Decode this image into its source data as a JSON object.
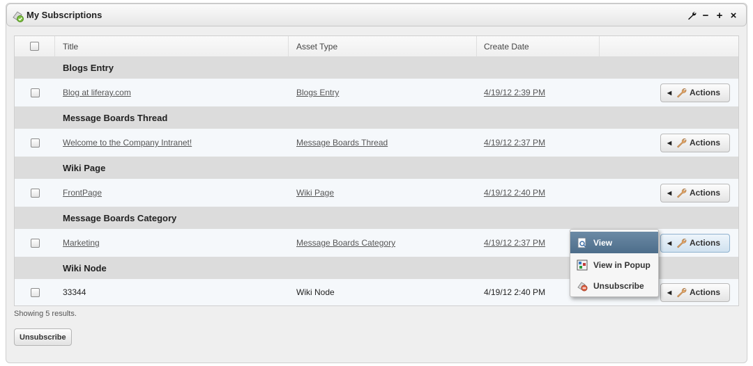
{
  "portlet": {
    "title": "My Subscriptions",
    "controls": {
      "configure_icon": "wrench-icon",
      "minimize": "−",
      "maximize": "+",
      "close": "×"
    }
  },
  "table": {
    "headers": {
      "title": "Title",
      "asset_type": "Asset Type",
      "create_date": "Create Date"
    },
    "groups": [
      {
        "label": "Blogs Entry",
        "row": {
          "title": "Blog at liferay.com",
          "asset_type": "Blogs Entry",
          "create_date": "4/19/12 2:39 PM",
          "linked": true,
          "actions_label": "Actions"
        }
      },
      {
        "label": "Message Boards Thread",
        "row": {
          "title": "Welcome to the Company Intranet!",
          "asset_type": "Message Boards Thread",
          "create_date": "4/19/12 2:37 PM",
          "linked": true,
          "actions_label": "Actions"
        }
      },
      {
        "label": "Wiki Page",
        "row": {
          "title": "FrontPage",
          "asset_type": "Wiki Page",
          "create_date": "4/19/12 2:40 PM",
          "linked": true,
          "actions_label": "Actions"
        }
      },
      {
        "label": "Message Boards Category",
        "row": {
          "title": "Marketing",
          "asset_type": "Message Boards Category",
          "create_date": "4/19/12 2:37 PM",
          "linked": true,
          "actions_label": "Actions"
        }
      },
      {
        "label": "Wiki Node",
        "row": {
          "title": "33344",
          "asset_type": "Wiki Node",
          "create_date": "4/19/12 2:40 PM",
          "linked": false,
          "actions_label": "Actions"
        }
      }
    ]
  },
  "actions_menu": {
    "items": [
      {
        "label": "View",
        "icon": "view-page-icon"
      },
      {
        "label": "View in Popup",
        "icon": "popup-icon"
      },
      {
        "label": "Unsubscribe",
        "icon": "unsubscribe-icon"
      }
    ]
  },
  "footer": {
    "results_text": "Showing 5 results.",
    "unsubscribe_label": "Unsubscribe"
  },
  "colors": {
    "menu_highlight": "#5a7a97",
    "group_row": "#dcdcdc",
    "item_row": "#f5f8fb"
  }
}
